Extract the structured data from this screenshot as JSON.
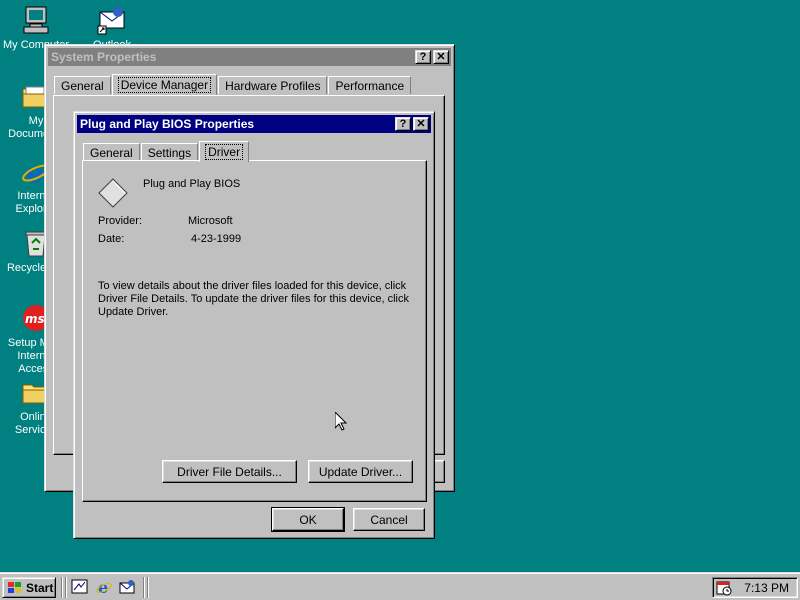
{
  "desktop": {
    "icons": [
      {
        "label": "My Computer",
        "icon": "my-computer-icon"
      },
      {
        "label": "Outlook Express",
        "icon": "outlook-icon"
      },
      {
        "label": "My Documents",
        "icon": "folder-icon"
      },
      {
        "label": "Internet Explorer",
        "icon": "internet-explorer-icon"
      },
      {
        "label": "Recycle Bin",
        "icon": "recycle-bin-icon"
      },
      {
        "label": "Setup MSN Internet Access",
        "icon": "msn-icon"
      },
      {
        "label": "Online Services",
        "icon": "folder-icon"
      }
    ]
  },
  "system_properties": {
    "title": "System Properties",
    "help_label": "?",
    "close_label": "✕",
    "tabs": [
      "General",
      "Device Manager",
      "Hardware Profiles",
      "Performance"
    ],
    "selected_tab": "Device Manager"
  },
  "pnp_dialog": {
    "title": "Plug and Play BIOS Properties",
    "help_label": "?",
    "close_label": "✕",
    "tabs": [
      "General",
      "Settings",
      "Driver"
    ],
    "selected_tab": "Driver",
    "device_name": "Plug and Play BIOS",
    "provider_label": "Provider:",
    "provider_value": "Microsoft",
    "date_label": "Date:",
    "date_value": "4-23-1999",
    "description_lines": [
      "To view details about the driver files loaded for this device, click",
      "Driver File Details.  To update the driver files for this device, click",
      "Update Driver."
    ],
    "driver_file_details_button": "Driver File Details...",
    "update_driver_button": "Update Driver...",
    "ok_button": "OK",
    "cancel_button": "Cancel"
  },
  "taskbar": {
    "start_label": "Start",
    "quick_launch": [
      "show-desktop-icon",
      "internet-explorer-icon",
      "outlook-icon"
    ],
    "clock": "7:13 PM"
  },
  "colors": {
    "desktop": "#008080",
    "active_title": "#000080",
    "inactive_title": "#808080",
    "face": "#c0c0c0"
  }
}
